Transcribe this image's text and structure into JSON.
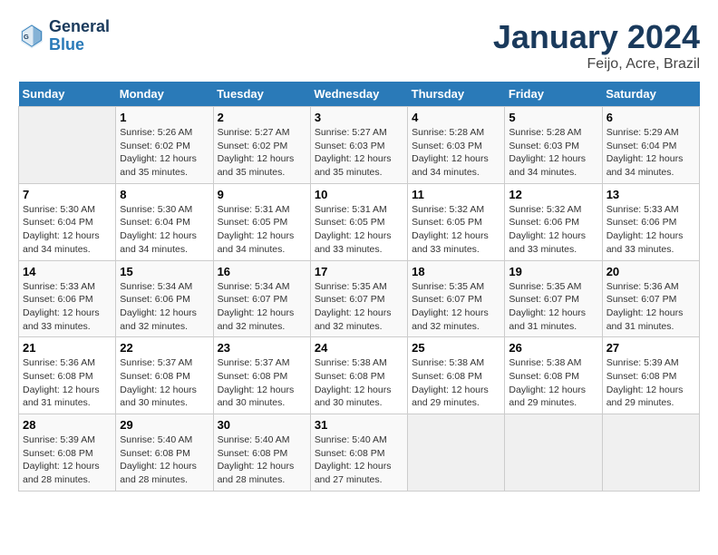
{
  "logo": {
    "text_general": "General",
    "text_blue": "Blue"
  },
  "header": {
    "title": "January 2024",
    "subtitle": "Feijo, Acre, Brazil"
  },
  "columns": [
    "Sunday",
    "Monday",
    "Tuesday",
    "Wednesday",
    "Thursday",
    "Friday",
    "Saturday"
  ],
  "weeks": [
    [
      {
        "day": "",
        "empty": true
      },
      {
        "day": "1",
        "sunrise": "Sunrise: 5:26 AM",
        "sunset": "Sunset: 6:02 PM",
        "daylight": "Daylight: 12 hours",
        "daylight2": "and 35 minutes."
      },
      {
        "day": "2",
        "sunrise": "Sunrise: 5:27 AM",
        "sunset": "Sunset: 6:02 PM",
        "daylight": "Daylight: 12 hours",
        "daylight2": "and 35 minutes."
      },
      {
        "day": "3",
        "sunrise": "Sunrise: 5:27 AM",
        "sunset": "Sunset: 6:03 PM",
        "daylight": "Daylight: 12 hours",
        "daylight2": "and 35 minutes."
      },
      {
        "day": "4",
        "sunrise": "Sunrise: 5:28 AM",
        "sunset": "Sunset: 6:03 PM",
        "daylight": "Daylight: 12 hours",
        "daylight2": "and 34 minutes."
      },
      {
        "day": "5",
        "sunrise": "Sunrise: 5:28 AM",
        "sunset": "Sunset: 6:03 PM",
        "daylight": "Daylight: 12 hours",
        "daylight2": "and 34 minutes."
      },
      {
        "day": "6",
        "sunrise": "Sunrise: 5:29 AM",
        "sunset": "Sunset: 6:04 PM",
        "daylight": "Daylight: 12 hours",
        "daylight2": "and 34 minutes."
      }
    ],
    [
      {
        "day": "7",
        "sunrise": "Sunrise: 5:30 AM",
        "sunset": "Sunset: 6:04 PM",
        "daylight": "Daylight: 12 hours",
        "daylight2": "and 34 minutes."
      },
      {
        "day": "8",
        "sunrise": "Sunrise: 5:30 AM",
        "sunset": "Sunset: 6:04 PM",
        "daylight": "Daylight: 12 hours",
        "daylight2": "and 34 minutes."
      },
      {
        "day": "9",
        "sunrise": "Sunrise: 5:31 AM",
        "sunset": "Sunset: 6:05 PM",
        "daylight": "Daylight: 12 hours",
        "daylight2": "and 34 minutes."
      },
      {
        "day": "10",
        "sunrise": "Sunrise: 5:31 AM",
        "sunset": "Sunset: 6:05 PM",
        "daylight": "Daylight: 12 hours",
        "daylight2": "and 33 minutes."
      },
      {
        "day": "11",
        "sunrise": "Sunrise: 5:32 AM",
        "sunset": "Sunset: 6:05 PM",
        "daylight": "Daylight: 12 hours",
        "daylight2": "and 33 minutes."
      },
      {
        "day": "12",
        "sunrise": "Sunrise: 5:32 AM",
        "sunset": "Sunset: 6:06 PM",
        "daylight": "Daylight: 12 hours",
        "daylight2": "and 33 minutes."
      },
      {
        "day": "13",
        "sunrise": "Sunrise: 5:33 AM",
        "sunset": "Sunset: 6:06 PM",
        "daylight": "Daylight: 12 hours",
        "daylight2": "and 33 minutes."
      }
    ],
    [
      {
        "day": "14",
        "sunrise": "Sunrise: 5:33 AM",
        "sunset": "Sunset: 6:06 PM",
        "daylight": "Daylight: 12 hours",
        "daylight2": "and 33 minutes."
      },
      {
        "day": "15",
        "sunrise": "Sunrise: 5:34 AM",
        "sunset": "Sunset: 6:06 PM",
        "daylight": "Daylight: 12 hours",
        "daylight2": "and 32 minutes."
      },
      {
        "day": "16",
        "sunrise": "Sunrise: 5:34 AM",
        "sunset": "Sunset: 6:07 PM",
        "daylight": "Daylight: 12 hours",
        "daylight2": "and 32 minutes."
      },
      {
        "day": "17",
        "sunrise": "Sunrise: 5:35 AM",
        "sunset": "Sunset: 6:07 PM",
        "daylight": "Daylight: 12 hours",
        "daylight2": "and 32 minutes."
      },
      {
        "day": "18",
        "sunrise": "Sunrise: 5:35 AM",
        "sunset": "Sunset: 6:07 PM",
        "daylight": "Daylight: 12 hours",
        "daylight2": "and 32 minutes."
      },
      {
        "day": "19",
        "sunrise": "Sunrise: 5:35 AM",
        "sunset": "Sunset: 6:07 PM",
        "daylight": "Daylight: 12 hours",
        "daylight2": "and 31 minutes."
      },
      {
        "day": "20",
        "sunrise": "Sunrise: 5:36 AM",
        "sunset": "Sunset: 6:07 PM",
        "daylight": "Daylight: 12 hours",
        "daylight2": "and 31 minutes."
      }
    ],
    [
      {
        "day": "21",
        "sunrise": "Sunrise: 5:36 AM",
        "sunset": "Sunset: 6:08 PM",
        "daylight": "Daylight: 12 hours",
        "daylight2": "and 31 minutes."
      },
      {
        "day": "22",
        "sunrise": "Sunrise: 5:37 AM",
        "sunset": "Sunset: 6:08 PM",
        "daylight": "Daylight: 12 hours",
        "daylight2": "and 30 minutes."
      },
      {
        "day": "23",
        "sunrise": "Sunrise: 5:37 AM",
        "sunset": "Sunset: 6:08 PM",
        "daylight": "Daylight: 12 hours",
        "daylight2": "and 30 minutes."
      },
      {
        "day": "24",
        "sunrise": "Sunrise: 5:38 AM",
        "sunset": "Sunset: 6:08 PM",
        "daylight": "Daylight: 12 hours",
        "daylight2": "and 30 minutes."
      },
      {
        "day": "25",
        "sunrise": "Sunrise: 5:38 AM",
        "sunset": "Sunset: 6:08 PM",
        "daylight": "Daylight: 12 hours",
        "daylight2": "and 29 minutes."
      },
      {
        "day": "26",
        "sunrise": "Sunrise: 5:38 AM",
        "sunset": "Sunset: 6:08 PM",
        "daylight": "Daylight: 12 hours",
        "daylight2": "and 29 minutes."
      },
      {
        "day": "27",
        "sunrise": "Sunrise: 5:39 AM",
        "sunset": "Sunset: 6:08 PM",
        "daylight": "Daylight: 12 hours",
        "daylight2": "and 29 minutes."
      }
    ],
    [
      {
        "day": "28",
        "sunrise": "Sunrise: 5:39 AM",
        "sunset": "Sunset: 6:08 PM",
        "daylight": "Daylight: 12 hours",
        "daylight2": "and 28 minutes."
      },
      {
        "day": "29",
        "sunrise": "Sunrise: 5:40 AM",
        "sunset": "Sunset: 6:08 PM",
        "daylight": "Daylight: 12 hours",
        "daylight2": "and 28 minutes."
      },
      {
        "day": "30",
        "sunrise": "Sunrise: 5:40 AM",
        "sunset": "Sunset: 6:08 PM",
        "daylight": "Daylight: 12 hours",
        "daylight2": "and 28 minutes."
      },
      {
        "day": "31",
        "sunrise": "Sunrise: 5:40 AM",
        "sunset": "Sunset: 6:08 PM",
        "daylight": "Daylight: 12 hours",
        "daylight2": "and 27 minutes."
      },
      {
        "day": "",
        "empty": true
      },
      {
        "day": "",
        "empty": true
      },
      {
        "day": "",
        "empty": true
      }
    ]
  ]
}
